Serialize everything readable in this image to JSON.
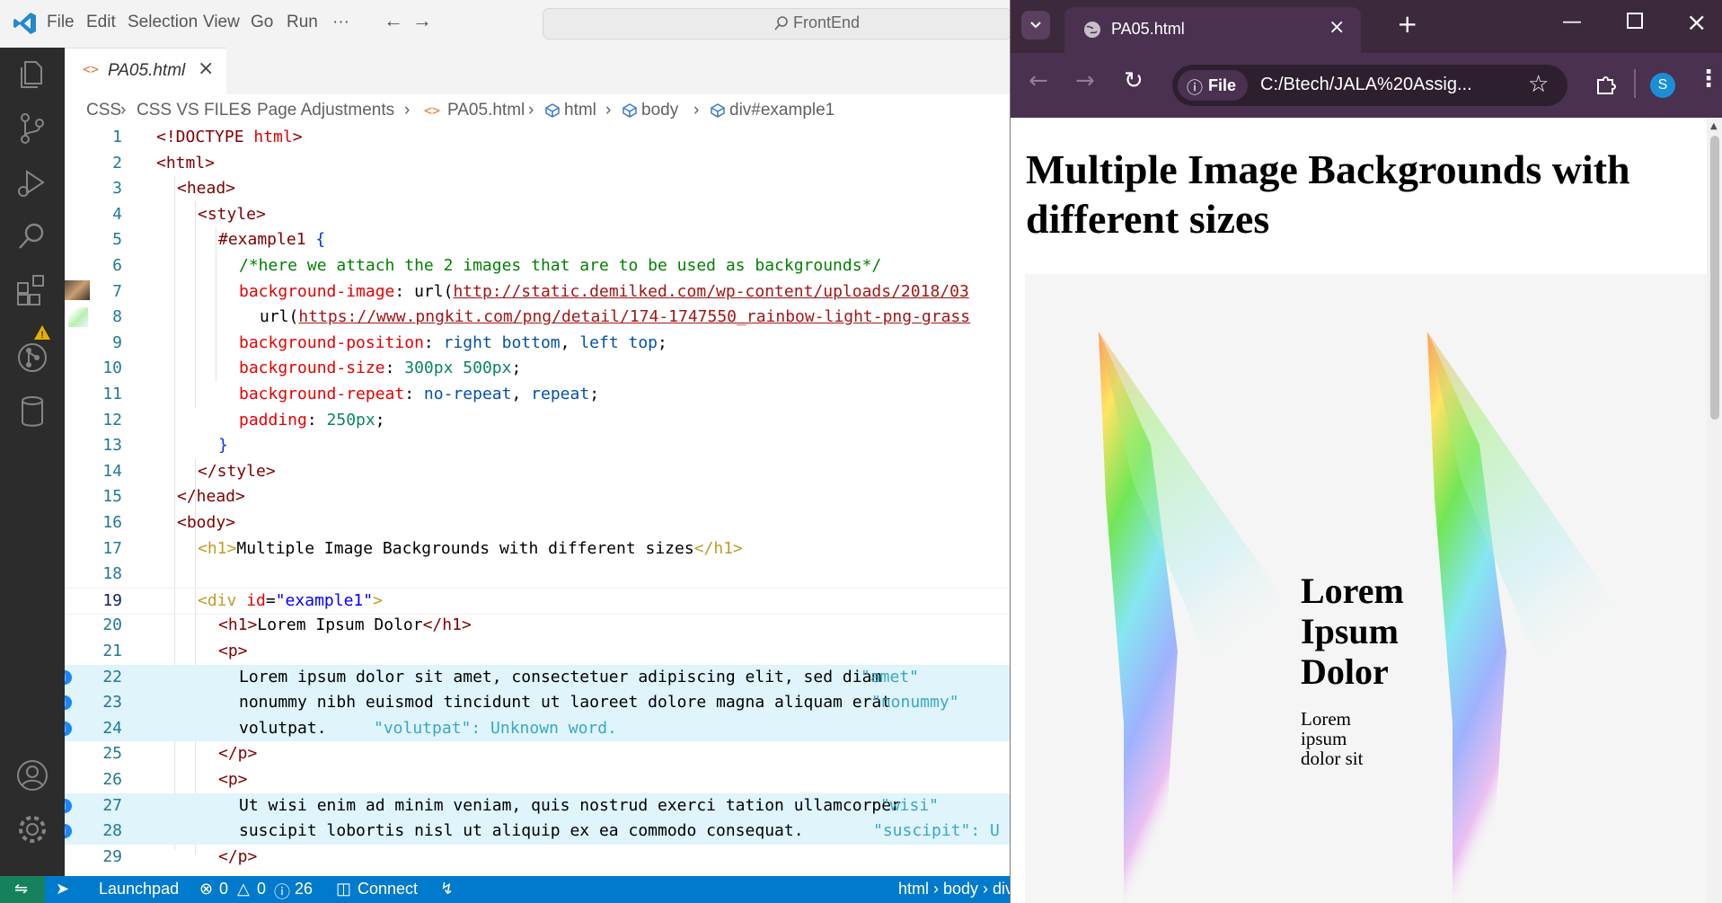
{
  "vscode": {
    "menu": [
      "File",
      "Edit",
      "Selection",
      "View",
      "Go",
      "Run",
      "···"
    ],
    "command_center": "FrontEnd",
    "tab": {
      "filename": "PA05.html"
    },
    "breadcrumbs": [
      "CSS",
      "CSS VS FILES",
      "Page Adjustments",
      "PA05.html",
      "html",
      "body",
      "div#example1"
    ],
    "editor_lines": [
      {
        "n": "1"
      },
      {
        "n": "2"
      },
      {
        "n": "3"
      },
      {
        "n": "4"
      },
      {
        "n": "5"
      },
      {
        "n": "6"
      },
      {
        "n": "7"
      },
      {
        "n": "8"
      },
      {
        "n": "9"
      },
      {
        "n": "10"
      },
      {
        "n": "11"
      },
      {
        "n": "12"
      },
      {
        "n": "13"
      },
      {
        "n": "14"
      },
      {
        "n": "15"
      },
      {
        "n": "16"
      },
      {
        "n": "17"
      },
      {
        "n": "18"
      },
      {
        "n": "19"
      },
      {
        "n": "20"
      },
      {
        "n": "21"
      },
      {
        "n": "22"
      },
      {
        "n": "23"
      },
      {
        "n": "24"
      },
      {
        "n": "25"
      },
      {
        "n": "26"
      },
      {
        "n": "27"
      },
      {
        "n": "28"
      },
      {
        "n": "29"
      }
    ],
    "code": {
      "l1_a": "<!DOCTYPE ",
      "l1_b": "html",
      "l1_c": ">",
      "l2": "<html>",
      "l3": "<head>",
      "l4": "<style>",
      "l5_a": "#example1 ",
      "l5_b": "{",
      "l6": "/*here we attach the 2 images that are to be used as backgrounds*/",
      "l7_a": "background-image",
      ":": ": ",
      "l7_b": "url(",
      "l7_url": "http://static.demilked.com/wp-content/uploads/2018/03",
      "l8_a": "url(",
      "l8_url": "https://www.pngkit.com/png/detail/174-1747550_rainbow-light-png-grass",
      "l9_a": "background-position",
      "l9_b": "right bottom",
      "l9_c": "left top",
      "l10_a": "background-size",
      "l10_b": "300px 500px",
      "l11_a": "background-repeat",
      "l11_b": "no-repeat",
      "l11_c": "repeat",
      "l12_a": "padding",
      "l12_b": "250px",
      "l13": "}",
      "l14": "</style>",
      "l15": "</head>",
      "l16": "<body>",
      "l17_a": "<h1>",
      "l17_b": "Multiple Image Backgrounds with different sizes",
      "l17_c": "</h1>",
      "l19_a": "<div ",
      "l19_b": "id",
      "l19_c": "=",
      "l19_d": "\"example1\"",
      "l19_e": ">",
      "l20_a": "<h1>",
      "l20_b": "Lorem Ipsum Dolor",
      "l20_c": "</h1>",
      "l21": "<p>",
      "l22": "Lorem ipsum dolor sit amet, consectetuer adipiscing elit, sed diam",
      "l22_hint": "\"amet\"",
      "l23": "nonummy nibh euismod tincidunt ut laoreet dolore magna aliquam erat",
      "l23_hint": "\"nonummy\"",
      "l24": "volutpat.",
      "l24_hint": "\"volutpat\": Unknown word.",
      "l25": "</p>",
      "l26": "<p>",
      "l27": "Ut wisi enim ad minim veniam, quis nostrud exerci tation ullamcorper",
      "l27_hint": "\"wisi\"",
      "l28": "suscipit lobortis nisl ut aliquip ex ea commodo consequat.",
      "l28_hint": "\"suscipit\": U",
      "l29": "</p>"
    },
    "status": {
      "launchpad": "Launchpad",
      "errors": "0",
      "warnings": "0",
      "infos": "26",
      "connect": "Connect",
      "path": "html › body › div"
    }
  },
  "chrome": {
    "tab_title": "PA05.html",
    "file_chip": "File",
    "address": "C:/Btech/JALA%20Assig...",
    "profile_initial": "S",
    "page": {
      "heading": "Multiple Image Backgrounds with different sizes",
      "inner_heading": "Lorem Ipsum Dolor",
      "paragraph": "Lorem ipsum dolor sit"
    }
  },
  "colors": {
    "accent": "#007acc",
    "chrome_frame": "#4a3150",
    "highlight": "#dff4fb"
  }
}
